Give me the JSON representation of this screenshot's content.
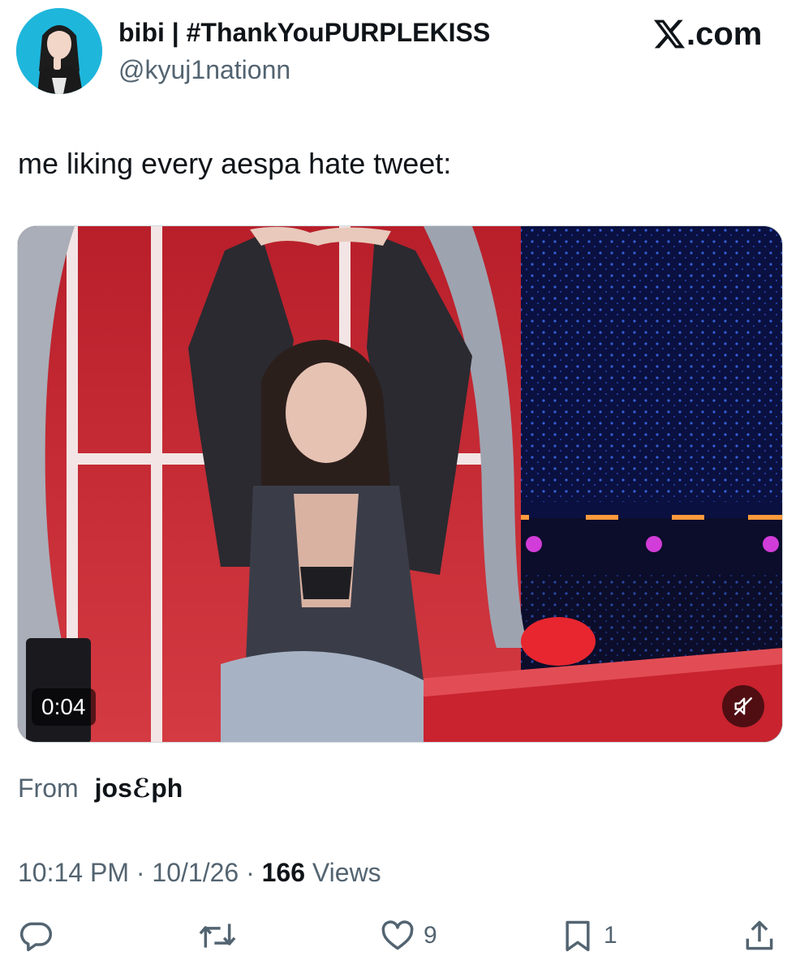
{
  "author": {
    "display_name": "bibi | #ThankYouPURPLEKISS",
    "handle": "@kyuj1nationn",
    "avatar_icon": "profile-photo"
  },
  "brand": {
    "logo_icon": "x-logo-icon",
    "text": ".com"
  },
  "tweet": {
    "text": "me liking every aespa hate tweet:"
  },
  "media": {
    "type": "video",
    "duration": "0:04",
    "mute_icon": "muted-speaker-icon"
  },
  "attribution": {
    "label": "From",
    "name": "josℰph"
  },
  "meta": {
    "time": "10:14 PM",
    "separator": "·",
    "date": "10/1/26",
    "views_count": "166",
    "views_label": "Views"
  },
  "actions": {
    "reply": {
      "icon": "reply-icon",
      "count": ""
    },
    "retweet": {
      "icon": "retweet-icon",
      "count": ""
    },
    "like": {
      "icon": "heart-icon",
      "count": "9"
    },
    "bookmark": {
      "icon": "bookmark-icon",
      "count": "1"
    },
    "share": {
      "icon": "share-icon",
      "count": ""
    }
  },
  "colors": {
    "text_primary": "#0f1419",
    "text_secondary": "#536471",
    "background": "#ffffff"
  }
}
